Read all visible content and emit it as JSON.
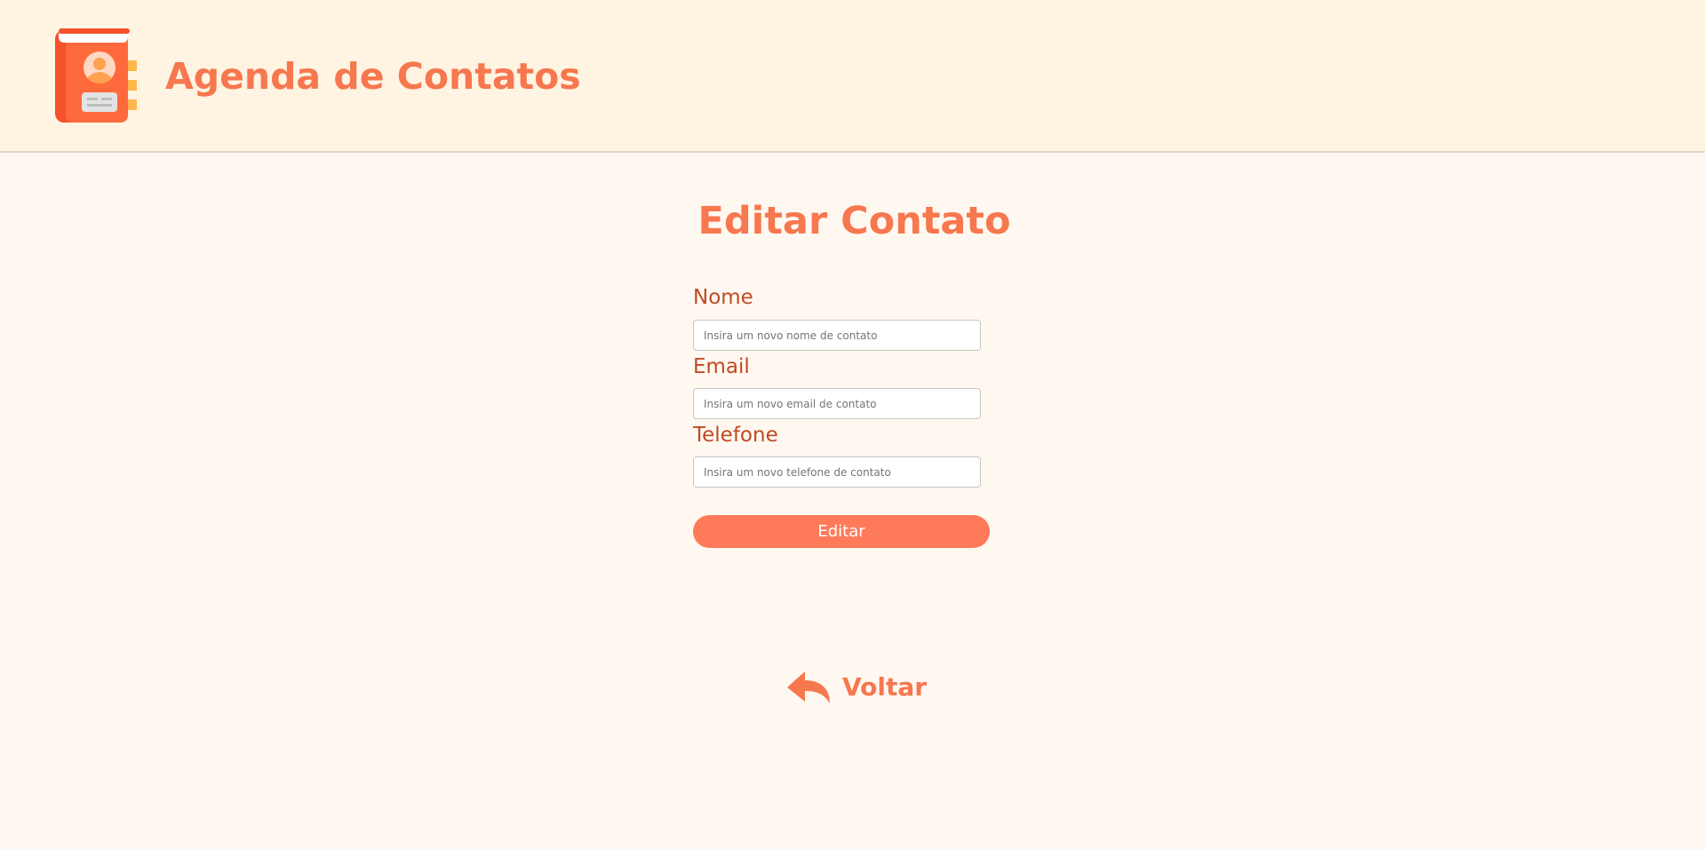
{
  "header": {
    "app_title": "Agenda de Contatos",
    "logo_icon": "address-book-icon"
  },
  "page": {
    "title": "Editar Contato"
  },
  "form": {
    "fields": [
      {
        "label": "Nome",
        "placeholder": "Insira um novo nome de contato",
        "value": ""
      },
      {
        "label": "Email",
        "placeholder": "Insira um novo email de contato",
        "value": ""
      },
      {
        "label": "Telefone",
        "placeholder": "Insira um novo telefone de contato",
        "value": ""
      }
    ],
    "submit_label": "Editar"
  },
  "back": {
    "label": "Voltar",
    "icon": "reply-arrow-icon"
  },
  "colors": {
    "accent": "#f7774f",
    "button": "#ff7a59",
    "label": "#c04a22",
    "header_bg": "#fff4e1",
    "page_bg": "#fff8f1"
  }
}
